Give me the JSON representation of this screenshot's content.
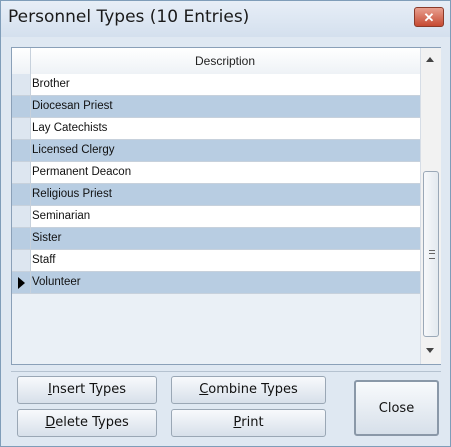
{
  "window": {
    "title": "Personnel Types (10 Entries)",
    "close_glyph": "✕"
  },
  "grid": {
    "column_header": "Description",
    "rows": [
      "Brother",
      "Diocesan Priest",
      "Lay Catechists",
      "Licensed Clergy",
      "Permanent Deacon",
      "Religious Priest",
      "Seminarian",
      "Sister",
      "Staff",
      "Volunteer"
    ],
    "current_row_index": 9
  },
  "buttons": {
    "insert": {
      "mnemonic": "I",
      "rest": "nsert Types"
    },
    "combine": {
      "mnemonic": "C",
      "rest": "ombine Types"
    },
    "delete": {
      "mnemonic": "D",
      "rest": "elete Types"
    },
    "print": {
      "mnemonic": "P",
      "rest": "rint"
    },
    "close": "Close"
  },
  "colors": {
    "title_bg": "#dfe8f2",
    "row_alt": "#b8cde2",
    "row": "#ffffff",
    "close_x": "#c64a32"
  },
  "icons": {
    "title_close": "close-icon",
    "row_pointer": "row-pointer-icon"
  }
}
